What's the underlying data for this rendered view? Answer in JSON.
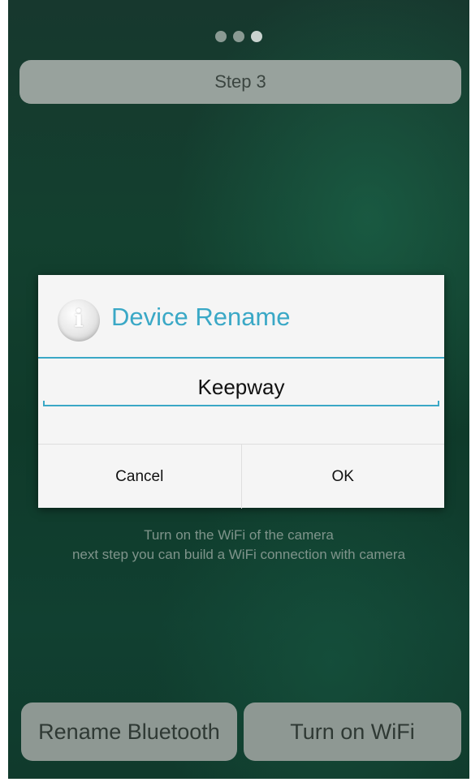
{
  "pager": {
    "dot_count": 3,
    "active_index": 2
  },
  "header": {
    "step_label": "Step 3"
  },
  "dialog": {
    "title": "Device Rename",
    "icon": "info-icon",
    "input_value": "Keepway",
    "cancel_label": "Cancel",
    "ok_label": "OK"
  },
  "info": {
    "line1": "Turn on the WiFi of the camera",
    "line2": "next step you can build a WiFi connection with camera"
  },
  "actions": {
    "rename_label": "Rename Bluetooth",
    "wifi_label": "Turn on WiFi"
  },
  "colors": {
    "accent": "#3aa8c6",
    "background": "#133d2e"
  }
}
